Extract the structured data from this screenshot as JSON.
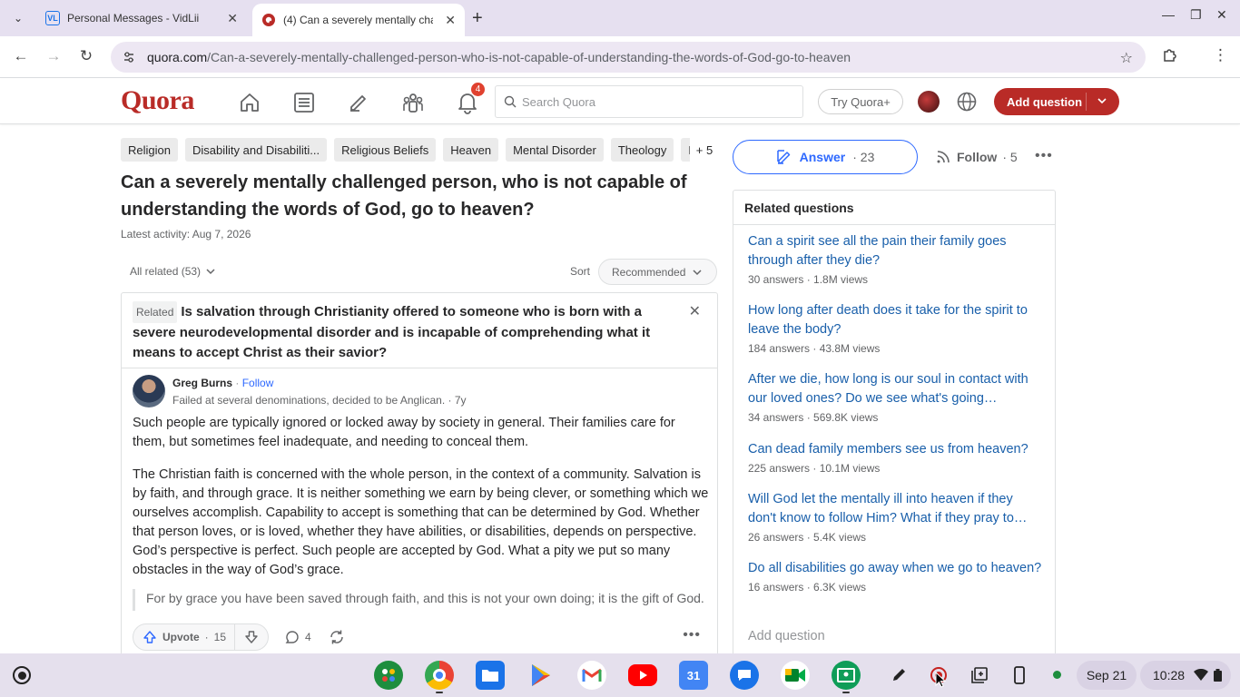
{
  "browser": {
    "tabs": [
      {
        "title": "Personal Messages - VidLii",
        "favicon": "VL",
        "active": false
      },
      {
        "title": "(4) Can a severely mentally cha",
        "favicon": "Q",
        "active": true
      }
    ],
    "url_domain": "quora.com",
    "url_path": "/Can-a-severely-mentally-challenged-person-who-is-not-capable-of-understanding-the-words-of-God-go-to-heaven"
  },
  "quora": {
    "logo": "Quora",
    "notification_count": "4",
    "search_placeholder": "Search Quora",
    "try_plus": "Try Quora+",
    "add_question": "Add question"
  },
  "question": {
    "topics": [
      "Religion",
      "Disability and Disabiliti...",
      "Religious Beliefs",
      "Heaven",
      "Mental Disorder",
      "Theology",
      "D"
    ],
    "topics_more": "+ 5",
    "title": "Can a severely mentally challenged person, who is not capable of understanding the words of God, go to heaven?",
    "latest_activity": "Latest activity: Aug 7, 2026",
    "all_related": "All related (53)",
    "sort_label": "Sort",
    "sort_value": "Recommended",
    "answer_label": "Answer",
    "answer_count": "23",
    "follow_label": "Follow",
    "follow_count": "5"
  },
  "card": {
    "related_badge": "Related",
    "related_question": "Is salvation through Christianity offered to someone who is born with a severe neurodevelopmental disorder and is incapable of comprehending what it means to accept Christ as their savior?",
    "author": "Greg Burns",
    "follow": "Follow",
    "credential": "Failed at several denominations, decided to be Anglican. · 7y",
    "paragraph1": "Such people are typically ignored or locked away by society in general. Their families care for them, but sometimes feel inadequate, and needing to conceal them.",
    "paragraph2": "The Christian faith is concerned with the whole person, in the context of a community. Salvation is by faith, and through grace. It is neither something we earn by being clever, or something which we ourselves accomplish. Capability to accept is something that can be determined by God. Whether that person loves, or is loved, whether they have abilities, or disabilities, depends on perspective. God’s perspective is perfect. Such people are accepted by God. What a pity we put so many obstacles in the way of God’s grace.",
    "quote": "For by grace you have been saved through faith, and this is not your own doing; it is the gift of God.[1]",
    "upvote_label": "Upvote",
    "upvote_count": "15",
    "comment_count": "4"
  },
  "related": {
    "title": "Related questions",
    "items": [
      {
        "q": "Can a spirit see all the pain their family goes through after they die?",
        "stats": "30 answers · 1.8M views"
      },
      {
        "q": "How long after death does it take for the spirit to leave the body?",
        "stats": "184 answers · 43.8M views"
      },
      {
        "q": "After we die, how long is our soul in contact with our loved ones? Do we see what's going…",
        "stats": "34 answers · 569.8K views"
      },
      {
        "q": "Can dead family members see us from heaven?",
        "stats": "225 answers · 10.1M views"
      },
      {
        "q": "Will God let the mentally ill into heaven if they don't know to follow Him? What if they pray to…",
        "stats": "26 answers · 5.4K views"
      },
      {
        "q": "Do all disabilities go away when we go to heaven?",
        "stats": "16 answers · 6.3K views"
      }
    ],
    "add_question": "Add question"
  },
  "shelf": {
    "calendar_day": "31",
    "date": "Sep 21",
    "time": "10:28"
  },
  "colors": {
    "brand": "#b92b27",
    "link": "#195faa",
    "accent_blue": "#2e69ff"
  }
}
